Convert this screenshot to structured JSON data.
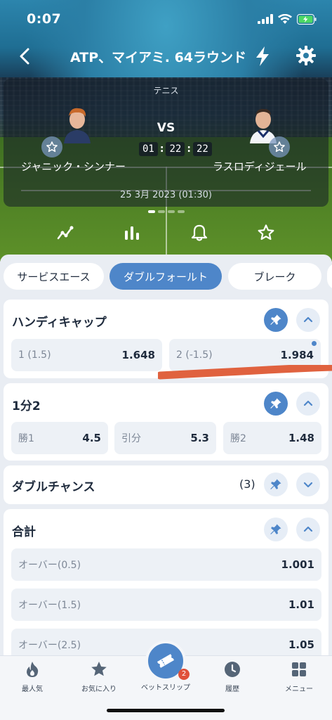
{
  "status_bar": {
    "time": "0:07"
  },
  "header": {
    "title": "ATP、マイアミ. 64ラウンド"
  },
  "match": {
    "sport": "テニス",
    "vs": "VS",
    "player1": "ジャニック・シンナー",
    "player2": "ラスロディジェール",
    "timer": {
      "h": "01",
      "m": "22",
      "s": "22"
    },
    "date": "25 3月 2023 (01:30)"
  },
  "tabs": [
    "サービスエース",
    "ダブルフォールト",
    "ブレーク"
  ],
  "markets": {
    "handicap": {
      "title": "ハンディキャップ",
      "odds": [
        {
          "label": "1 (1.5)",
          "value": "1.648"
        },
        {
          "label": "2 (-1.5)",
          "value": "1.984"
        }
      ]
    },
    "one_x_two": {
      "title": "1分2",
      "odds": [
        {
          "label": "勝1",
          "value": "4.5"
        },
        {
          "label": "引分",
          "value": "5.3"
        },
        {
          "label": "勝2",
          "value": "1.48"
        }
      ]
    },
    "double_chance": {
      "title": "ダブルチャンス",
      "count": "(3)"
    },
    "total": {
      "title": "合計",
      "odds": [
        {
          "label": "オーバー(0.5)",
          "value": "1.001"
        },
        {
          "label": "オーバー(1.5)",
          "value": "1.01"
        },
        {
          "label": "オーバー(2.5)",
          "value": "1.05"
        }
      ]
    }
  },
  "bottom_nav": {
    "popular": "最人気",
    "favorites": "お気に入り",
    "betslip": "ベットスリップ",
    "betslip_badge": "2",
    "history": "履歴",
    "menu": "メニュー"
  },
  "colors": {
    "accent": "#4e86c9",
    "badge": "#e0513a",
    "annotation": "#e0623f"
  },
  "icons": [
    "back-icon",
    "bolt-icon",
    "gear-icon",
    "star-icon",
    "chart-line-icon",
    "stats-bars-icon",
    "bell-icon",
    "pin-icon",
    "chevron-up-icon",
    "chevron-down-icon",
    "fire-icon",
    "ticket-icon",
    "clock-icon",
    "grid-icon"
  ]
}
